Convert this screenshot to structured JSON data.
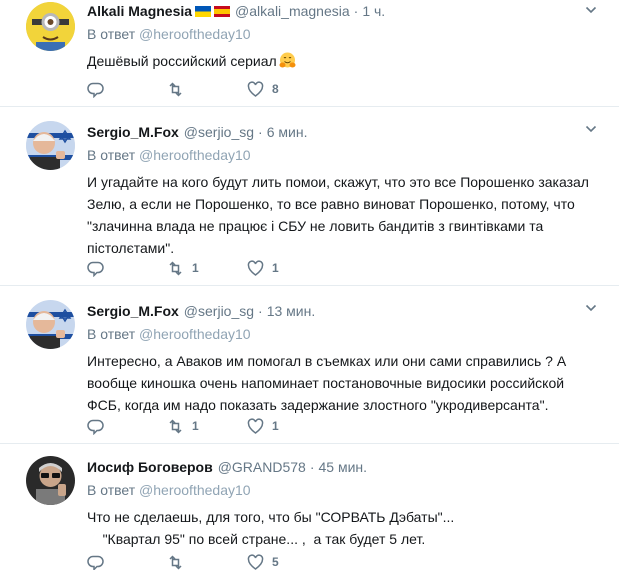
{
  "tweets": [
    {
      "name": "Alkali Magnesia",
      "handle": "@alkali_magnesia",
      "dot": "·",
      "time": "1 ч.",
      "reply_prefix": "В ответ",
      "reply_mention": "@herooftheday10",
      "text": "Дешёвый российский сериал",
      "replies": "",
      "retweets": "",
      "likes": "8"
    },
    {
      "name": "Sergio_M.Fox",
      "handle": "@serjio_sg",
      "dot": "·",
      "time": "6 мин.",
      "reply_prefix": "В ответ",
      "reply_mention": "@herooftheday10",
      "text": "И угадайте на кого будут лить помои, скажут, что это все Порошенко заказал\nЗелю, а если не Порошенко, то все равно виноват Порошенко, потому, что\n\"злачинна влада не працює і СБУ не ловить бандитів з гвинтівками та\nпістолєтами\".",
      "replies": "",
      "retweets": "1",
      "likes": "1"
    },
    {
      "name": "Sergio_M.Fox",
      "handle": "@serjio_sg",
      "dot": "·",
      "time": "13 мин.",
      "reply_prefix": "В ответ",
      "reply_mention": "@herooftheday10",
      "text": "Интересно, а Аваков им помогал в съемках или они сами справились ? А\nвообще киношка очень напоминает постановочные видосики российской\nФСБ, когда им надо показать задержание злостного \"укродиверсанта\".",
      "replies": "",
      "retweets": "1",
      "likes": "1"
    },
    {
      "name": "Иосиф Боговеров",
      "handle": "@GRAND578",
      "dot": "·",
      "time": "45 мин.",
      "reply_prefix": "В ответ",
      "reply_mention": "@herooftheday10",
      "text": "Что не сделаешь, для того, что бы \"СОРВАТЬ Дэбаты\"...\n    \"Квартал 95\" по всей стране... ,  а так будет 5 лет.",
      "replies": "",
      "retweets": "",
      "likes": "5"
    }
  ],
  "icons": {
    "reply": "reply-icon",
    "retweet": "retweet-icon",
    "like": "heart-icon",
    "more": "chevron-down-icon",
    "hug_emoji": "hugging-face-emoji"
  },
  "colors": {
    "text": "#14171a",
    "secondary": "#657786",
    "divider": "#e6ecf0",
    "ukraine_blue": "#0057b7",
    "ukraine_yellow": "#ffd700"
  }
}
